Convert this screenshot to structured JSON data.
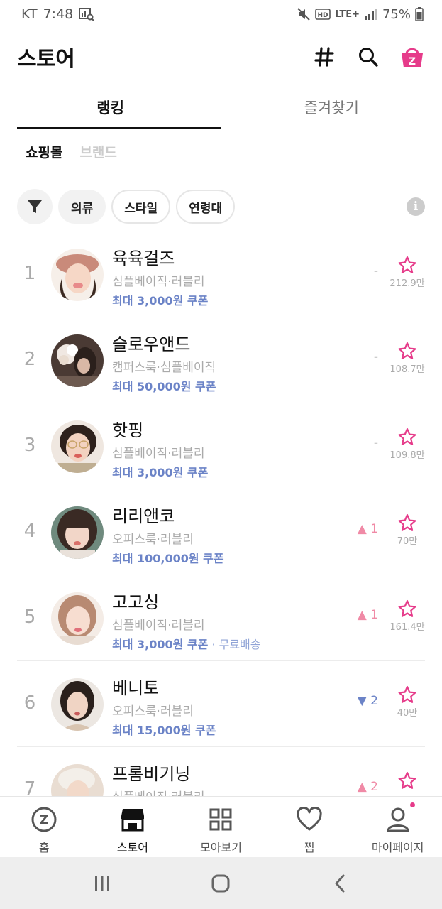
{
  "status_bar": {
    "carrier": "KT",
    "time": "7:48",
    "network": "LTE+",
    "battery": "75%"
  },
  "header": {
    "title": "스토어",
    "icons": [
      "hashtag-icon",
      "search-icon",
      "cart-icon"
    ]
  },
  "top_tabs": [
    {
      "label": "랭킹",
      "active": true
    },
    {
      "label": "즐겨찾기",
      "active": false
    }
  ],
  "sub_tabs": [
    {
      "label": "쇼핑몰",
      "active": true
    },
    {
      "label": "브랜드",
      "active": false
    }
  ],
  "filters": {
    "chips": [
      "의류",
      "스타일",
      "연령대"
    ]
  },
  "shops": [
    {
      "rank": "1",
      "name": "육육걸즈",
      "tags": "심플베이직·러블리",
      "coupon": "최대 3,000원 쿠폰",
      "extra": "",
      "change": "-",
      "change_dir": "none",
      "favorites": "212.9만"
    },
    {
      "rank": "2",
      "name": "슬로우앤드",
      "tags": "캠퍼스룩·심플베이직",
      "coupon": "최대 50,000원 쿠폰",
      "extra": "",
      "change": "-",
      "change_dir": "none",
      "favorites": "108.7만"
    },
    {
      "rank": "3",
      "name": "핫핑",
      "tags": "심플베이직·러블리",
      "coupon": "최대 3,000원 쿠폰",
      "extra": "",
      "change": "-",
      "change_dir": "none",
      "favorites": "109.8만"
    },
    {
      "rank": "4",
      "name": "리리앤코",
      "tags": "오피스룩·러블리",
      "coupon": "최대 100,000원 쿠폰",
      "extra": "",
      "change": "▲ 1",
      "change_dir": "up",
      "favorites": "70만"
    },
    {
      "rank": "5",
      "name": "고고싱",
      "tags": "심플베이직·러블리",
      "coupon": "최대 3,000원 쿠폰",
      "extra": " · 무료배송",
      "change": "▲ 1",
      "change_dir": "up",
      "favorites": "161.4만"
    },
    {
      "rank": "6",
      "name": "베니토",
      "tags": "오피스룩·러블리",
      "coupon": "최대 15,000원 쿠폰",
      "extra": "",
      "change": "▼ 2",
      "change_dir": "down",
      "favorites": "40만"
    },
    {
      "rank": "7",
      "name": "프롬비기닝",
      "tags": "심플베이직·러블리",
      "coupon": "",
      "extra": "",
      "change": "▲ 2",
      "change_dir": "up",
      "favorites": ""
    }
  ],
  "bottom_nav": [
    {
      "label": "홈",
      "icon": "zigzag-home-icon"
    },
    {
      "label": "스토어",
      "icon": "store-icon"
    },
    {
      "label": "모아보기",
      "icon": "grid-icon"
    },
    {
      "label": "찜",
      "icon": "heart-icon"
    },
    {
      "label": "마이페이지",
      "icon": "person-icon"
    }
  ],
  "colors": {
    "accent_pink": "#e63b8a",
    "coupon_blue": "#6b83c7",
    "rank_up": "#f08aa6"
  }
}
